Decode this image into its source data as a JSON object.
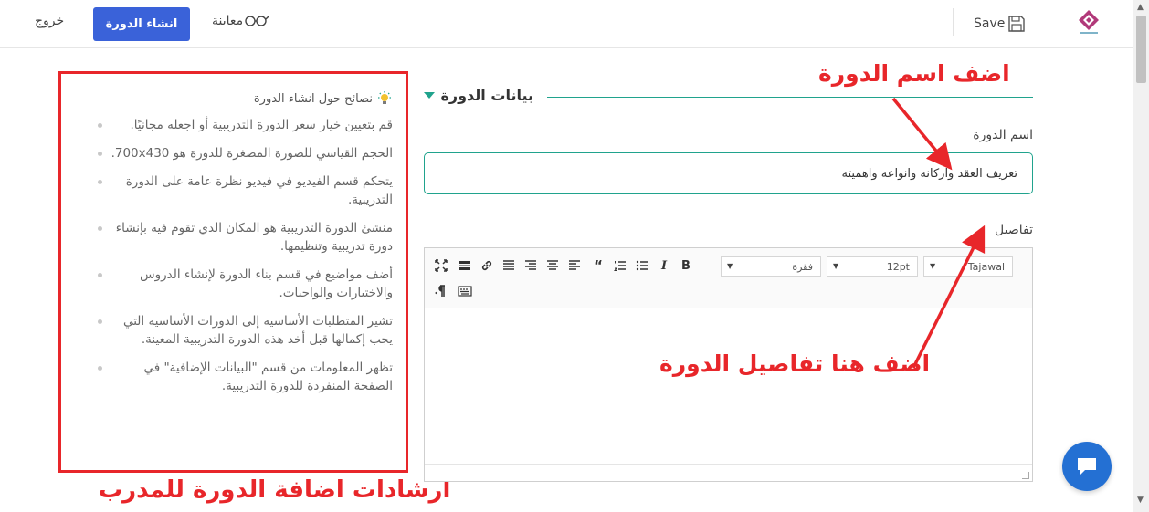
{
  "header": {
    "save_label": "Save",
    "exit_label": "خروج",
    "create_label": "انشاء الدورة",
    "preview_label": "معاينة"
  },
  "tips": {
    "title": "نصائح حول انشاء الدورة",
    "items": [
      "قم بتعيين خيار سعر الدورة التدريبية أو اجعله مجانيًا.",
      "الحجم القياسي للصورة المصغرة للدورة هو 700x430.",
      "يتحكم قسم الفيديو في فيديو نظرة عامة على الدورة التدريبية.",
      "منشئ الدورة التدريبية هو المكان الذي تقوم فيه بإنشاء دورة تدريبية وتنظيمها.",
      "أضف مواضيع في قسم بناء الدورة لإنشاء الدروس والاختبارات والواجبات.",
      "تشير المتطلبات الأساسية إلى الدورات الأساسية التي يجب إكمالها قبل أخذ هذه الدورة التدريبية المعينة.",
      "تظهر المعلومات من قسم \"البيانات الإضافية\" في الصفحة المنفردة للدورة التدريبية."
    ],
    "caption": "ارشادات اضافة الدورة للمدرب"
  },
  "section": {
    "title": "بيانات الدورة",
    "name_label": "اسم الدورة",
    "name_value": "تعريف العقد واركانه وانواعه واهميته",
    "details_label": "تفاصيل"
  },
  "editor": {
    "font_value": "Tajawal",
    "size_value": "12pt",
    "block_value": "فقرة"
  },
  "annotations": {
    "name_hint": "اضف اسم الدورة",
    "details_hint": "اضف هنا تفاصيل الدورة"
  },
  "colors": {
    "accent": "#3a62d9",
    "teal": "#20a38d",
    "annotation_red": "#e8262a",
    "chat_blue": "#2470d3"
  }
}
